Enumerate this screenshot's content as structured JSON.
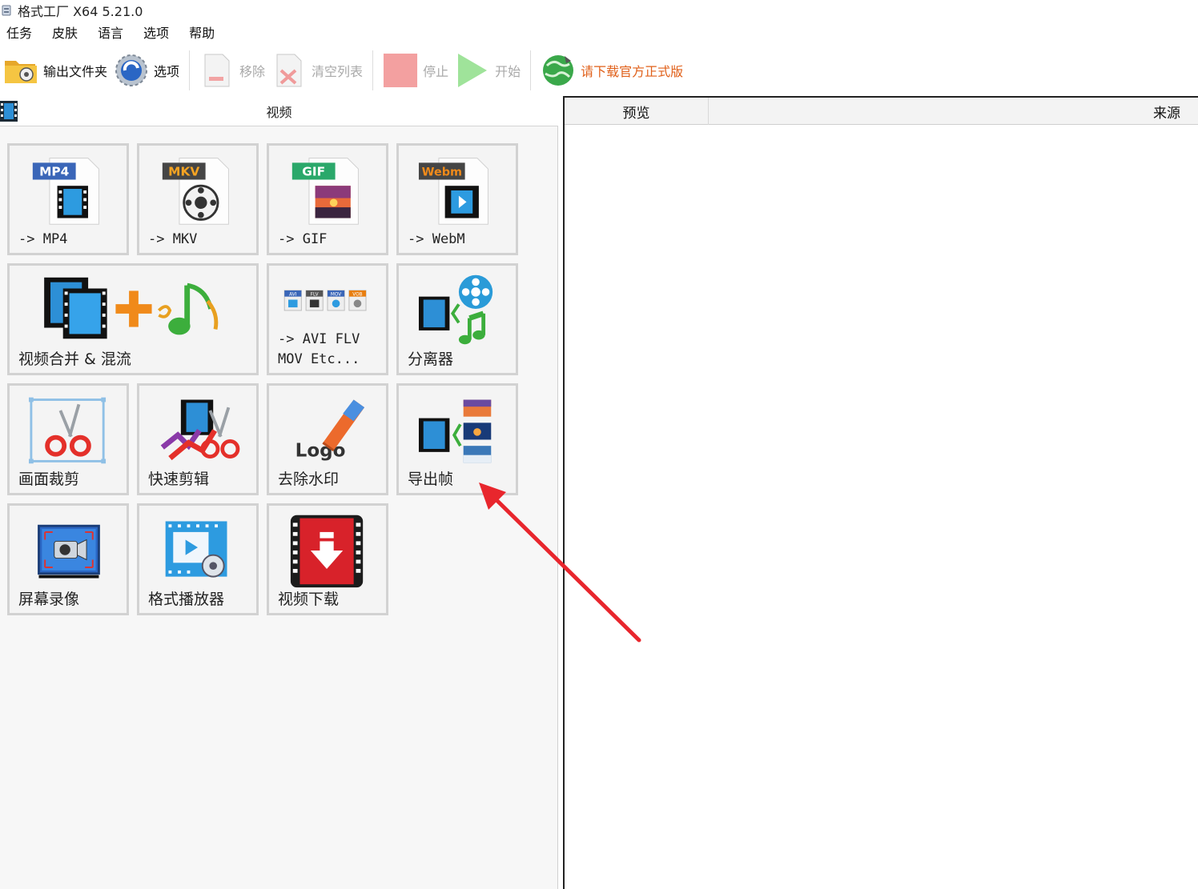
{
  "window": {
    "title": "格式工厂 X64 5.21.0"
  },
  "menu": [
    "任务",
    "皮肤",
    "语言",
    "选项",
    "帮助"
  ],
  "toolbar": {
    "output_folder": "输出文件夹",
    "options": "选项",
    "remove": "移除",
    "clear_list": "清空列表",
    "stop": "停止",
    "start": "开始",
    "promo": "请下载官方正式版"
  },
  "category": {
    "title": "视频"
  },
  "tiles": {
    "mp4": {
      "badge": "MP4",
      "label": "-> MP4",
      "badge_color": "#3a66b8"
    },
    "mkv": {
      "badge": "MKV",
      "label": "-> MKV",
      "badge_color": "#e8a020"
    },
    "gif": {
      "badge": "GIF",
      "label": "-> GIF",
      "badge_color": "#2aa86a"
    },
    "webm": {
      "badge": "Webm",
      "label": "-> WebM",
      "badge_color": "#e87e10"
    },
    "merge": {
      "label": "视频合并 & 混流"
    },
    "avi": {
      "label": "-> AVI FLV\nMOV Etc...",
      "mini_badges": [
        "AVI",
        "FLV",
        "MOV",
        "VOB"
      ]
    },
    "splitter": {
      "label": "分离器"
    },
    "crop": {
      "label": "画面裁剪"
    },
    "quickcut": {
      "label": "快速剪辑"
    },
    "watermark": {
      "label": "去除水印",
      "logo_text": "Logo"
    },
    "frames": {
      "label": "导出帧"
    },
    "record": {
      "label": "屏幕录像"
    },
    "player": {
      "label": "格式播放器"
    },
    "download": {
      "label": "视频下载"
    }
  },
  "list": {
    "col_preview": "预览",
    "col_source": "来源"
  },
  "colors": {
    "accent": "#e0601a",
    "annotation": "#e8262d",
    "tile_border": "#d2d2d2"
  }
}
